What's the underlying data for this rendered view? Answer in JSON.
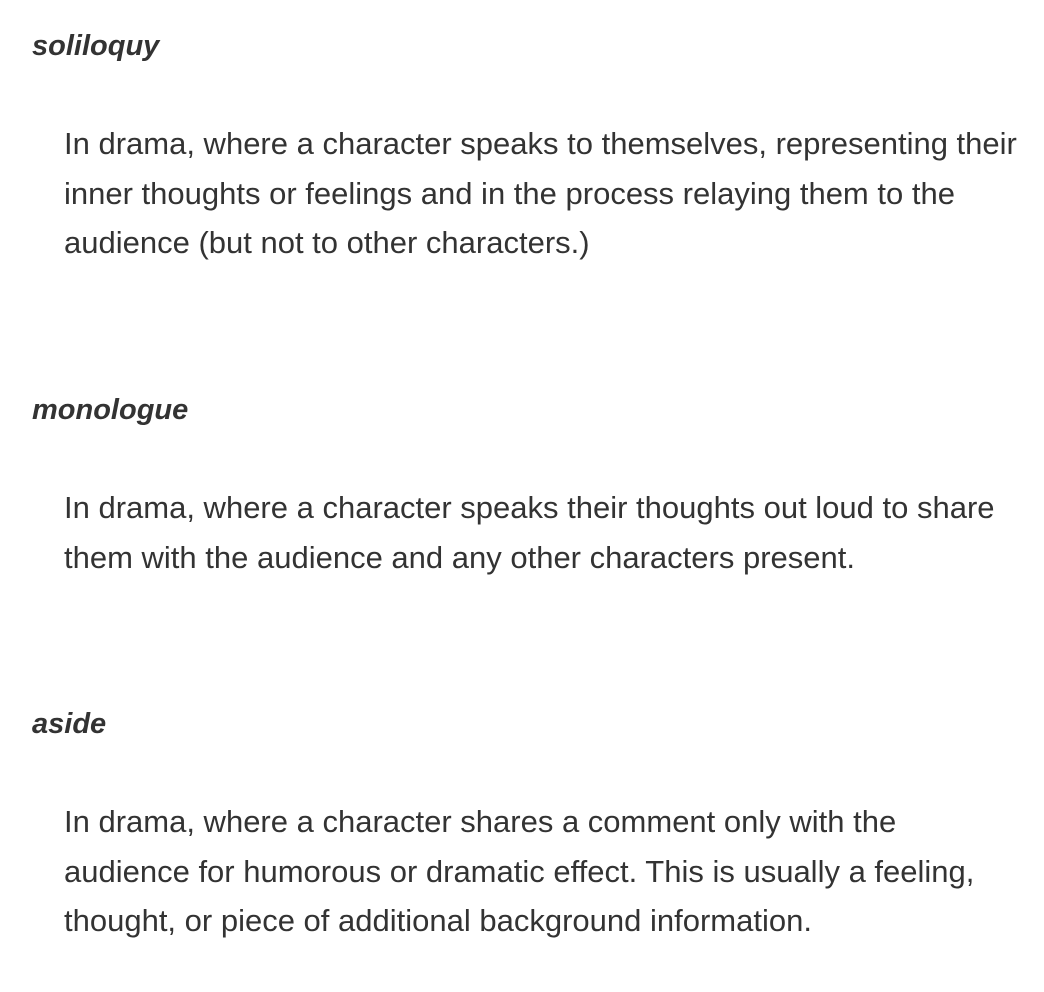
{
  "glossary": {
    "entries": [
      {
        "term": "soliloquy",
        "definition": "In drama, where a character speaks to themselves, representing their inner thoughts or feelings and in the process relaying them to the audience (but not to other characters.)"
      },
      {
        "term": "monologue",
        "definition": "In drama, where a character speaks their thoughts out loud to share them with the audience and any other characters present."
      },
      {
        "term": "aside",
        "definition": "In drama, where a character shares a comment only with the audience for humorous or dramatic effect. This is usually a feeling, thought, or piece of additional background information."
      }
    ]
  }
}
